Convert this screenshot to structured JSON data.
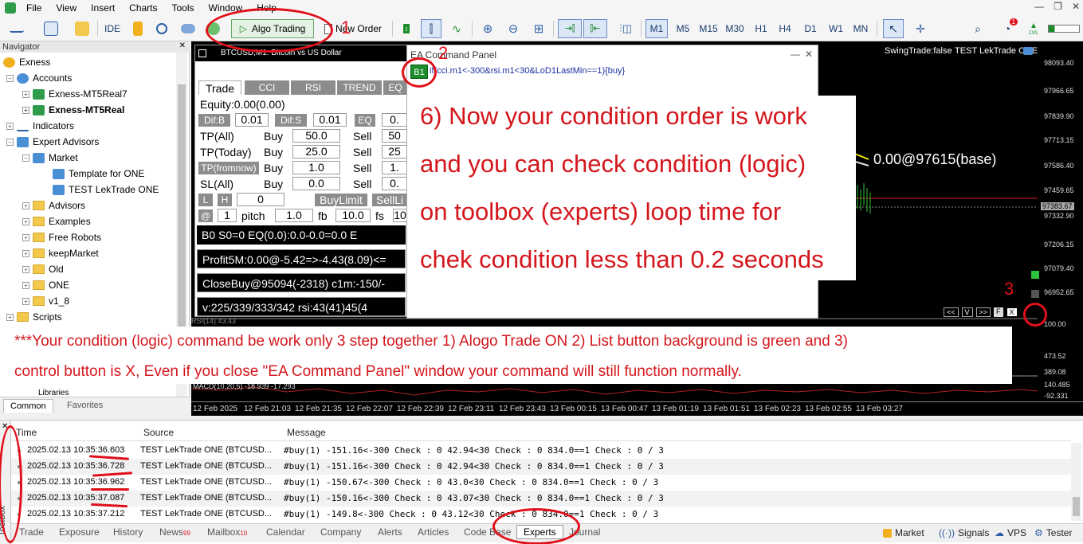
{
  "menu": [
    "File",
    "View",
    "Insert",
    "Charts",
    "Tools",
    "Window",
    "Help"
  ],
  "toolbar": {
    "ide_label": "IDE",
    "algo_trading_label": "Algo Trading",
    "new_order_label": "New Order",
    "timeframes": [
      "M1",
      "M5",
      "M15",
      "M30",
      "H1",
      "H4",
      "D1",
      "W1",
      "MN"
    ],
    "active_timeframe": "M1",
    "notifications": "1",
    "lvl_label": "LVL"
  },
  "navigator": {
    "title": "Navigator",
    "items": [
      {
        "label": "Exness",
        "indent": 0
      },
      {
        "label": "Accounts",
        "indent": 1
      },
      {
        "label": "Exness-MT5Real7",
        "indent": 2
      },
      {
        "label": "Exness-MT5Real",
        "indent": 2
      },
      {
        "label": "Indicators",
        "indent": 1
      },
      {
        "label": "Expert Advisors",
        "indent": 1
      },
      {
        "label": "Market",
        "indent": 2
      },
      {
        "label": "Template for ONE",
        "indent": 3
      },
      {
        "label": "TEST LekTrade ONE",
        "indent": 3
      },
      {
        "label": "Advisors",
        "indent": 2
      },
      {
        "label": "Examples",
        "indent": 2
      },
      {
        "label": "Free Robots",
        "indent": 2
      },
      {
        "label": "keepMarket",
        "indent": 2
      },
      {
        "label": "Old",
        "indent": 2
      },
      {
        "label": "ONE",
        "indent": 2
      },
      {
        "label": "v1_8",
        "indent": 2
      },
      {
        "label": "Scripts",
        "indent": 1
      }
    ],
    "partial_item": "Libraries",
    "tabs": [
      "Common",
      "Favorites"
    ]
  },
  "chart": {
    "title": "BTCUSD,M1: Bitcoin vs US Dollar",
    "overlay_top_right": "SwingTrade:false",
    "overlay_ea_name": "TEST LekTrade ONE",
    "base_label": "0.00@97615(base)",
    "prices": [
      "98093.40",
      "97966.65",
      "97839.90",
      "97713.15",
      "97586.40",
      "97459.65",
      "97383.67",
      "97332.90",
      "97206.15",
      "97079.40",
      "96952.65"
    ],
    "indicator_ticks": [
      "100.00",
      "473.52",
      "389.08",
      "140.485",
      "-92.331"
    ],
    "macd_label": "MACD(10,20,5) -18.939 -17.293",
    "times": [
      "12 Feb 2025",
      "12 Feb 21:03",
      "12 Feb 21:35",
      "12 Feb 22:07",
      "12 Feb 22:39",
      "12 Feb 23:11",
      "12 Feb 23:43",
      "13 Feb 00:15",
      "13 Feb 00:47",
      "13 Feb 01:19",
      "13 Feb 01:51",
      "13 Feb 02:23",
      "13 Feb 02:55",
      "13 Feb 03:27"
    ],
    "nav_buttons": [
      "<<",
      "V",
      ">>",
      "F",
      "X"
    ]
  },
  "trade_panel": {
    "tabs": [
      "Trade",
      "CCI",
      "RSI",
      "TREND",
      "EQ"
    ],
    "equity": "Equity:0.00(0.00)",
    "dif_b_label": "Dif:B",
    "dif_b_value": "0.01",
    "dif_s_label": "Dif:S",
    "dif_s_value": "0.01",
    "eq_label": "EQ",
    "eq_value": "0.",
    "rows": [
      {
        "label": "TP(All)",
        "buy": "50.0",
        "sell_val": "50"
      },
      {
        "label": "TP(Today)",
        "buy": "25.0",
        "sell_val": "25"
      },
      {
        "label": "TP(fromnow)",
        "buy": "1.0",
        "sell_val": "1."
      },
      {
        "label": "SL(All)",
        "buy": "0.0",
        "sell_val": "0."
      }
    ],
    "buy_word": "Buy",
    "sell_word": "Sell",
    "l_label": "L",
    "h_label": "H",
    "lh_value": "0",
    "buy_limit": "BuyLimit",
    "sell_limit": "SellLi",
    "at_label": "@",
    "at_value": "1",
    "pitch_label": "pitch",
    "pitch_value": "1.0",
    "fb_label": "fb",
    "fb_value": "10.0",
    "fs_label": "fs",
    "fs_value": "10",
    "status_rows": [
      "B0 S0=0 EQ(0.0):0.0-0.0=0.0 E",
      "Profit5M:0.00@-5.42=>-4.43(8.09)<=",
      "CloseBuy@95094(-2318) c1m:-150/-",
      "v:225/339/333/342 rsi:43(41)45(4"
    ]
  },
  "ea_panel": {
    "title": "EA Command Panel",
    "list_button": "B1",
    "command": "if(cci.m1<-300&rsi.m1<30&LoD1LastMin==1){buy}",
    "min_label": "—",
    "close_label": "✕"
  },
  "annotations": {
    "num1": "1",
    "num2": "2",
    "num3": "3",
    "note6": [
      "6) Now your condition order is work",
      "and you can check condition (logic)",
      "on toolbox (experts) loop time for",
      "chek condition less than 0.2 seconds"
    ],
    "note_bottom": [
      "***Your condition (logic) command be work only 3 step together 1) Alogo Trade ON 2) List button background is green and 3)",
      "control button is X, Even if you close \"EA Command Panel\" window your command will still function normally."
    ]
  },
  "toolbox": {
    "side_label": "Toolbox",
    "columns": [
      "Time",
      "Source",
      "Message"
    ],
    "rows": [
      {
        "time": "2025.02.13 10:35:36.603",
        "source": "TEST LekTrade ONE (BTCUSD...",
        "message": "#buy(1) -151.16<-300 Check : 0 42.94<30 Check : 0 834.0==1 Check : 0 / 3"
      },
      {
        "time": "2025.02.13 10:35:36.728",
        "source": "TEST LekTrade ONE (BTCUSD...",
        "message": "#buy(1) -151.16<-300 Check : 0 42.94<30 Check : 0 834.0==1 Check : 0 / 3"
      },
      {
        "time": "2025.02.13 10:35:36.962",
        "source": "TEST LekTrade ONE (BTCUSD...",
        "message": "#buy(1) -150.67<-300 Check : 0 43.0<30 Check : 0 834.0==1 Check : 0 / 3"
      },
      {
        "time": "2025.02.13 10:35:37.087",
        "source": "TEST LekTrade ONE (BTCUSD...",
        "message": "#buy(1) -150.16<-300 Check : 0 43.07<30 Check : 0 834.0==1 Check : 0 / 3"
      },
      {
        "time": "2025.02.13 10:35:37.212",
        "source": "TEST LekTrade ONE (BTCUSD...",
        "message": "#buy(1) -149.8<-300 Check : 0 43.12<30 Check : 0 834.0==1 Check : 0 / 3"
      }
    ],
    "tabs": [
      {
        "label": "Trade"
      },
      {
        "label": "Exposure"
      },
      {
        "label": "History"
      },
      {
        "label": "News",
        "badge": "99"
      },
      {
        "label": "Mailbox",
        "badge": "10"
      },
      {
        "label": "Calendar"
      },
      {
        "label": "Company"
      },
      {
        "label": "Alerts"
      },
      {
        "label": "Articles"
      },
      {
        "label": "Code Base"
      },
      {
        "label": "Experts"
      },
      {
        "label": "Journal"
      }
    ],
    "active_tab": "Experts",
    "right_tabs": [
      "Market",
      "Signals",
      "VPS",
      "Tester"
    ]
  },
  "colors": {
    "annotation_red": "#e0101a",
    "list_button_green": "#1c8c2a",
    "chart_bg": "#000000",
    "panel_gray": "#8c8c8c"
  }
}
